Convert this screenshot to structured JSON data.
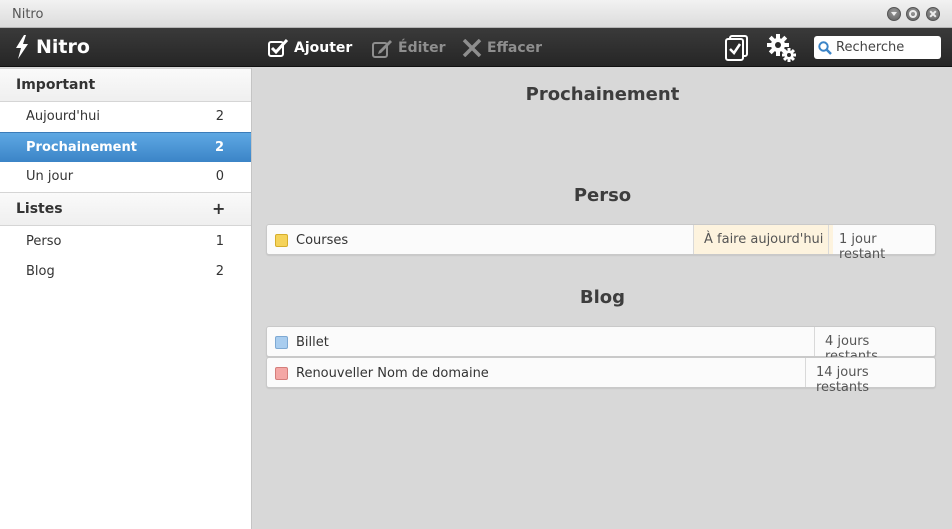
{
  "window": {
    "title": "Nitro"
  },
  "toolbar": {
    "brand": "Nitro",
    "add_label": "Ajouter",
    "edit_label": "Éditer",
    "delete_label": "Effacer",
    "search_placeholder": "Recherche"
  },
  "sidebar": {
    "important_heading": "Important",
    "important_items": [
      {
        "label": "Aujourd'hui",
        "count": "2"
      },
      {
        "label": "Prochainement",
        "count": "2"
      },
      {
        "label": "Un jour",
        "count": "0"
      }
    ],
    "lists_heading": "Listes",
    "add_list_symbol": "+",
    "list_items": [
      {
        "label": "Perso",
        "count": "1"
      },
      {
        "label": "Blog",
        "count": "2"
      }
    ]
  },
  "main": {
    "title": "Prochainement",
    "groups": [
      {
        "name": "Perso",
        "tasks": [
          {
            "name": "Courses",
            "color": "#f5d35a",
            "today": "À faire aujourd'hui",
            "remaining": "1 jour restant"
          }
        ]
      },
      {
        "name": "Blog",
        "tasks": [
          {
            "name": "Billet",
            "color": "#a9cdef",
            "remaining": "4 jours restants"
          },
          {
            "name": "Renouveller Nom de domaine",
            "color": "#f4a7a5",
            "remaining": "14 jours restants"
          }
        ]
      }
    ]
  },
  "colors": {
    "accent": "#3b84c7",
    "toolbar": "#2b2b2b"
  }
}
